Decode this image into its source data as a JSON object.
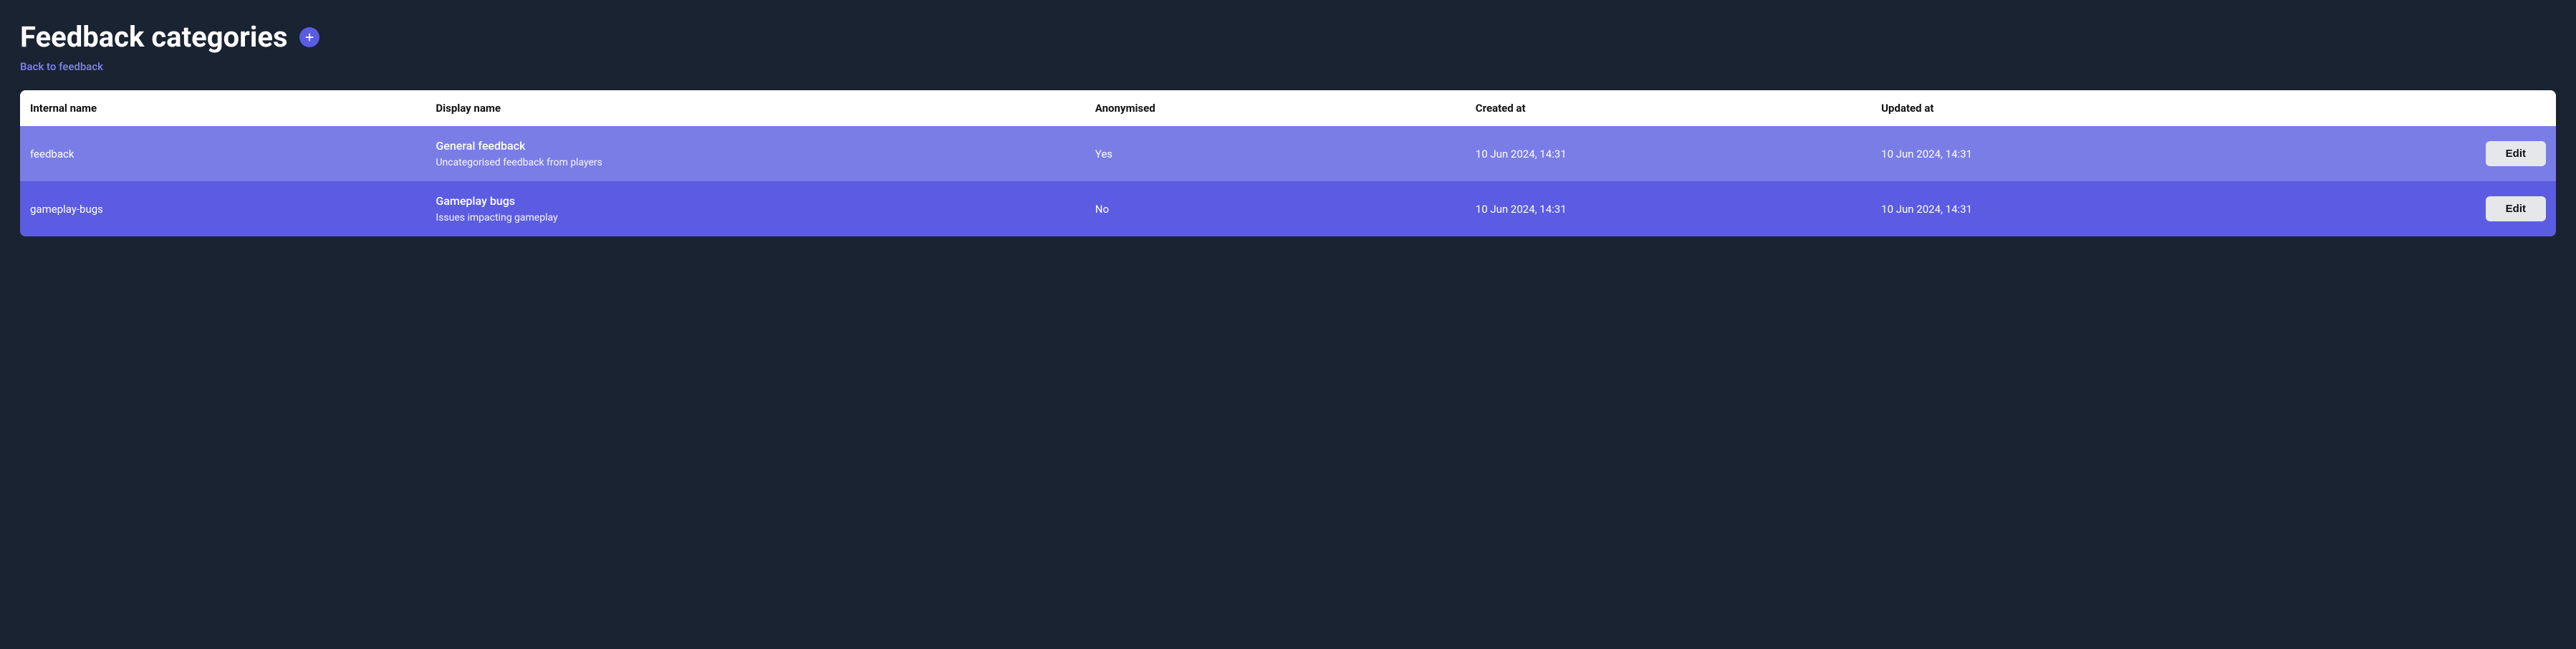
{
  "header": {
    "title": "Feedback categories",
    "back_link": "Back to feedback"
  },
  "table": {
    "columns": {
      "internal_name": "Internal name",
      "display_name": "Display name",
      "anonymised": "Anonymised",
      "created_at": "Created at",
      "updated_at": "Updated at"
    },
    "rows": [
      {
        "internal_name": "feedback",
        "display_name": "General feedback",
        "description": "Uncategorised feedback from players",
        "anonymised": "Yes",
        "created_at": "10 Jun 2024, 14:31",
        "updated_at": "10 Jun 2024, 14:31",
        "edit_label": "Edit"
      },
      {
        "internal_name": "gameplay-bugs",
        "display_name": "Gameplay bugs",
        "description": "Issues impacting gameplay",
        "anonymised": "No",
        "created_at": "10 Jun 2024, 14:31",
        "updated_at": "10 Jun 2024, 14:31",
        "edit_label": "Edit"
      }
    ]
  }
}
